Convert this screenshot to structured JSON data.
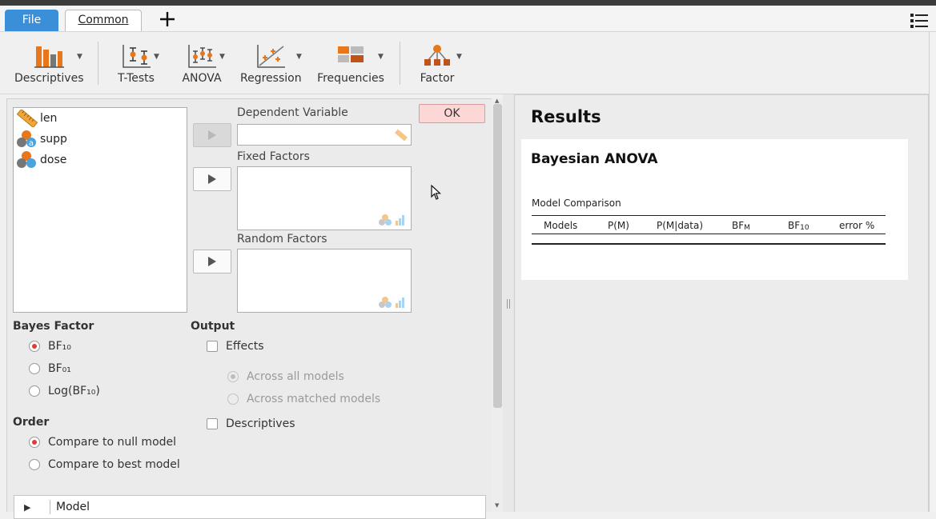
{
  "tabs": {
    "file": "File",
    "common": "Common",
    "add_icon": "plus-icon",
    "menu_icon": "list-menu-icon"
  },
  "ribbon": [
    {
      "id": "descriptives",
      "label": "Descriptives",
      "icon": "bar-chart-icon"
    },
    {
      "id": "ttests",
      "label": "T-Tests",
      "icon": "t-test-icon"
    },
    {
      "id": "anova",
      "label": "ANOVA",
      "icon": "anova-icon"
    },
    {
      "id": "regression",
      "label": "Regression",
      "icon": "regression-icon"
    },
    {
      "id": "frequencies",
      "label": "Frequencies",
      "icon": "frequencies-icon"
    },
    {
      "id": "factor",
      "label": "Factor",
      "icon": "factor-icon"
    }
  ],
  "variables": [
    {
      "name": "len",
      "icon": "ruler-icon"
    },
    {
      "name": "supp",
      "icon": "nominal-text-icon"
    },
    {
      "name": "dose",
      "icon": "nominal-icon"
    }
  ],
  "analysis": {
    "dependent_label": "Dependent Variable",
    "fixed_label": "Fixed Factors",
    "random_label": "Random Factors",
    "ok": "OK",
    "bayes_factor": {
      "title": "Bayes Factor",
      "options": [
        "BF₁₀",
        "BF₀₁",
        "Log(BF₁₀)"
      ],
      "selected": 0
    },
    "output": {
      "title": "Output",
      "effects": "Effects",
      "across_all": "Across all models",
      "across_matched": "Across matched models",
      "descriptives": "Descriptives"
    },
    "order": {
      "title": "Order",
      "options": [
        "Compare to null model",
        "Compare to best model"
      ],
      "selected": 0
    },
    "model_section": "Model"
  },
  "results": {
    "title": "Results",
    "analysis_title": "Bayesian ANOVA",
    "table_title": "Model Comparison",
    "columns": {
      "models": "Models",
      "pm": "P(M)",
      "pm_data": "P(M|data)",
      "bfm_main": "BF",
      "bfm_sub": "M",
      "bf10_main": "BF",
      "bf10_sub": "10",
      "error": "error %"
    }
  },
  "colors": {
    "accent": "#3a8fd8",
    "ok_bg": "#fcd7d6",
    "radio_on": "#e23b3b",
    "icon_orange": "#e8761a"
  }
}
